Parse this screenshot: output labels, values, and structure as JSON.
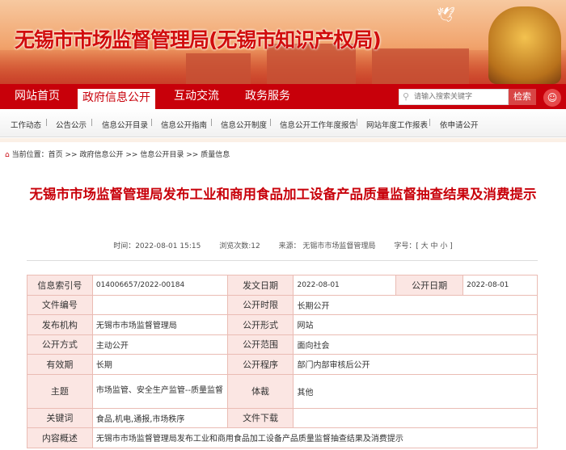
{
  "header": {
    "site_title": "无锡市市场监督管理局(无锡市知识产权局)"
  },
  "nav": {
    "items": [
      "网站首页",
      "政府信息公开",
      "互动交流",
      "政务服务"
    ],
    "active": 1,
    "search_placeholder": "请输入搜索关键字",
    "search_button": "检索"
  },
  "subnav": [
    "工作动态",
    "公告公示",
    "信息公开目录",
    "信息公开指南",
    "信息公开制度",
    "信息公开工作年度报告",
    "网站年度工作报表",
    "依申请公开"
  ],
  "breadcrumb": {
    "label": "当前位置：",
    "items": [
      "首页",
      "政府信息公开",
      "信息公开目录",
      "质量信息"
    ],
    "sep": ">>"
  },
  "article": {
    "title": "无锡市市场监督管理局发布工业和商用食品加工设备产品质量监督抽查结果及消费提示",
    "time": "时间：2022-08-01 15:15",
    "views": "浏览次数:12",
    "source": "来源： 无锡市市场监督管理局",
    "fontsize": "字号：[ 大 中 小 ]"
  },
  "info": {
    "r0": [
      "信息索引号",
      "014006657/2022-00184",
      "发文日期",
      "2022-08-01",
      "公开日期",
      "2022-08-01"
    ],
    "r1": [
      "文件编号",
      "",
      "公开时限",
      "长期公开"
    ],
    "r2": [
      "发布机构",
      "无锡市市场监督管理局",
      "公开形式",
      "网站"
    ],
    "r3": [
      "公开方式",
      "主动公开",
      "公开范围",
      "面向社会"
    ],
    "r4": [
      "有效期",
      "长期",
      "公开程序",
      "部门内部审核后公开"
    ],
    "r5": [
      "主题",
      "市场监管、安全生产监管--质量监督",
      "体裁",
      "其他"
    ],
    "r6": [
      "关键词",
      "食品,机电,通报,市场秩序",
      "文件下载",
      ""
    ],
    "r7": [
      "内容概述",
      "无锡市市场监督管理局发布工业和商用食品加工设备产品质量监督抽查结果及消费提示"
    ]
  },
  "colors": {
    "brand": "#c8000a",
    "label_bg": "#fbe6e3",
    "border": "#eabcb4"
  }
}
